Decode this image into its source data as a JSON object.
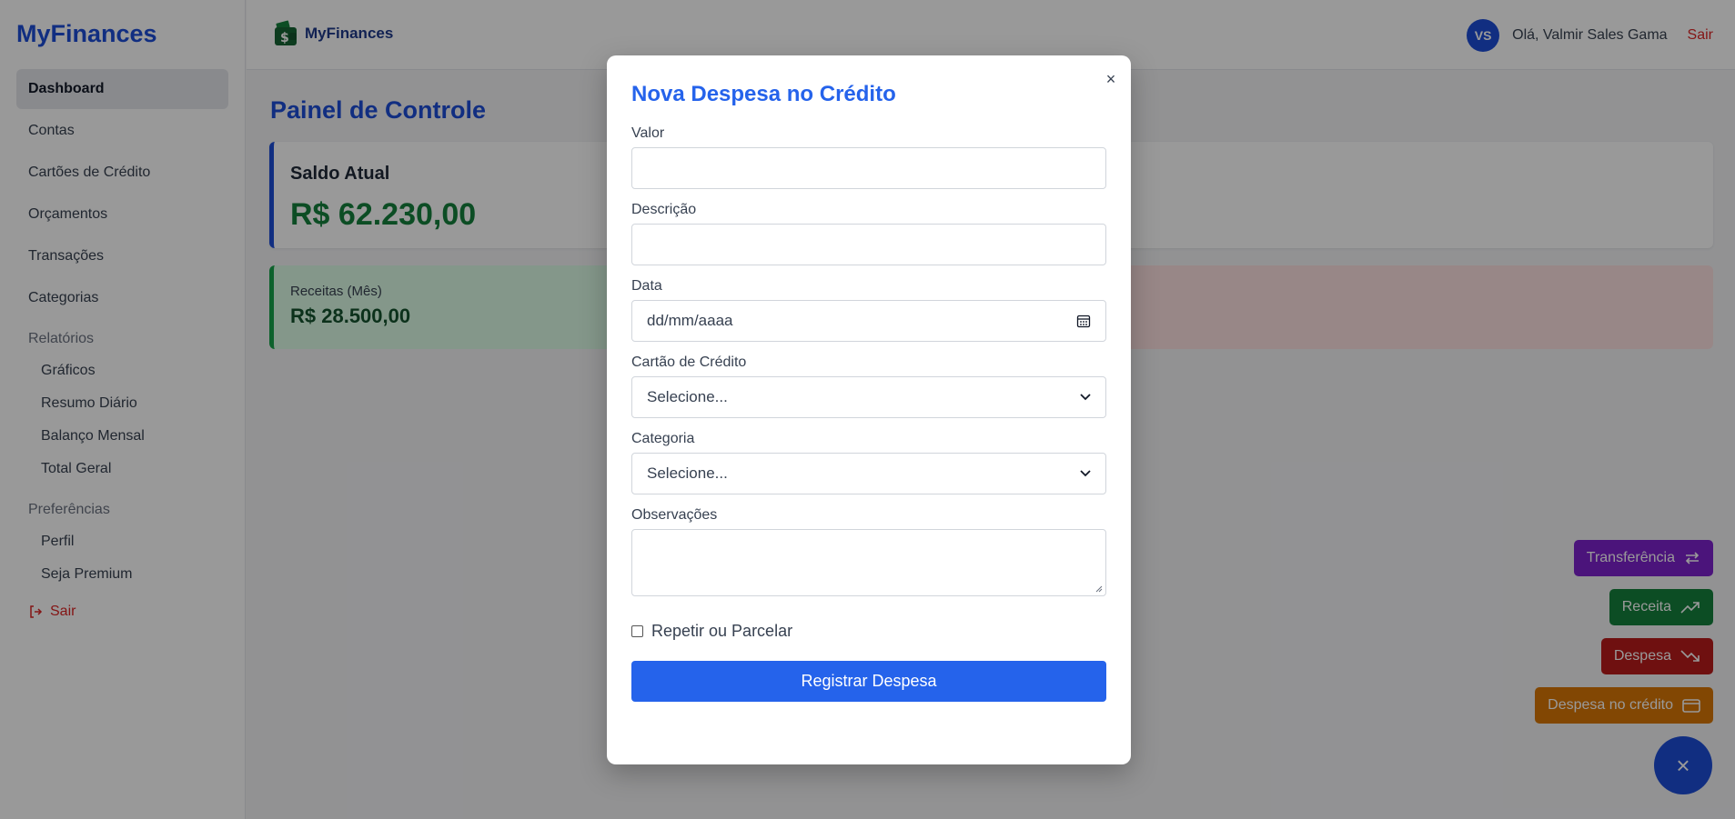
{
  "sidebar": {
    "brand": "MyFinances",
    "items": [
      {
        "label": "Dashboard"
      },
      {
        "label": "Contas"
      },
      {
        "label": "Cartões de Crédito"
      },
      {
        "label": "Orçamentos"
      },
      {
        "label": "Transações"
      },
      {
        "label": "Categorias"
      }
    ],
    "reports_section": "Relatórios",
    "reports": [
      {
        "label": "Gráficos"
      },
      {
        "label": "Resumo Diário"
      },
      {
        "label": "Balanço Mensal"
      },
      {
        "label": "Total Geral"
      }
    ],
    "prefs_section": "Preferências",
    "prefs": [
      {
        "label": "Perfil"
      },
      {
        "label": "Seja Premium"
      }
    ],
    "exit_label": "Sair"
  },
  "topbar": {
    "logo_text": "MyFinances",
    "avatar_initials": "VS",
    "greeting": "Olá, Valmir Sales Gama",
    "exit_label": "Sair"
  },
  "main": {
    "title": "Painel de Controle",
    "saldo": {
      "label": "Saldo Atual",
      "value": "R$ 62.230,00"
    },
    "receitas": {
      "label": "Receitas (Mês)",
      "value": "R$ 28.500,00"
    }
  },
  "fab": {
    "transfer": "Transferência",
    "receita": "Receita",
    "despesa": "Despesa",
    "credito": "Despesa no crédito",
    "close": "×"
  },
  "modal": {
    "title": "Nova Despesa no Crédito",
    "close": "×",
    "fields": {
      "valor": {
        "label": "Valor",
        "value": ""
      },
      "descricao": {
        "label": "Descrição",
        "value": ""
      },
      "data": {
        "label": "Data",
        "placeholder": "dd/mm/aaaa"
      },
      "cartao": {
        "label": "Cartão de Crédito",
        "selected": "Selecione..."
      },
      "categoria": {
        "label": "Categoria",
        "selected": "Selecione..."
      },
      "observacoes": {
        "label": "Observações",
        "value": ""
      }
    },
    "repeat_label": "Repetir ou Parcelar",
    "submit_label": "Registrar Despesa"
  },
  "colors": {
    "primary": "#2563eb",
    "brand": "#1d4ed8",
    "income": "#15803d",
    "expense": "#b91c1c",
    "transfer": "#7e22ce",
    "credit": "#d97706"
  }
}
